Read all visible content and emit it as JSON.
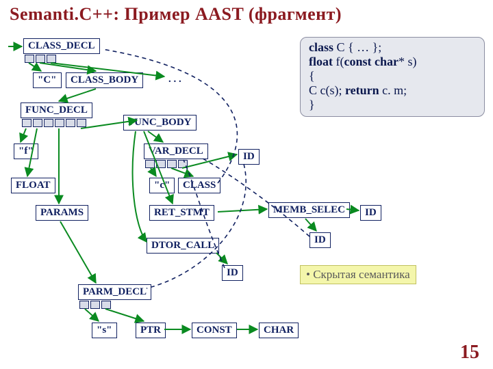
{
  "title": "Semanti.C++: Пример AAST (фрагмент)",
  "nodes": {
    "class_decl": "CLASS_DECL",
    "c_name": "\"C\"",
    "class_body": "CLASS_BODY",
    "ellipsis": ". . .",
    "func_decl": "FUNC_DECL",
    "func_body": "FUNC_BODY",
    "f_name": "\"f\"",
    "float_t": "FLOAT",
    "params": "PARAMS",
    "var_decl": "VAR_DECL",
    "c_var": "\"c\"",
    "class_t": "CLASS",
    "ret_stmt": "RET_STMT",
    "dtor_call": "DTOR_CALL",
    "memb_selec": "MEMB_SELEC",
    "id1": "ID",
    "id2": "ID",
    "id3": "ID",
    "id4": "ID",
    "parm_decl": "PARM_DECL",
    "s_name": "\"s\"",
    "ptr": "PTR",
    "const_t": "CONST",
    "char_t": "CHAR"
  },
  "code": {
    "l1a": "class",
    "l1b": " C { … };",
    "l2a": "float",
    "l2b": " f(",
    "l2c": "const char",
    "l2d": "* s)",
    "l3": "{",
    "l4a": "  C c(s); ",
    "l4b": "return",
    "l4c": " c. m;",
    "l5": "}"
  },
  "note": "• Скрытая семантика",
  "page": "15"
}
